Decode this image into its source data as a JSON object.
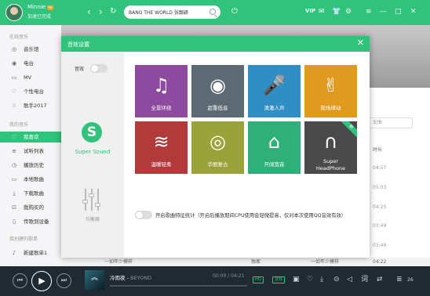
{
  "topbar": {
    "user_name": "Minnie",
    "level": "lv",
    "status": "加速已完成",
    "search_value": "BANG THE WORLD 张靓颖",
    "vip_label": "VIP",
    "icons": [
      "back-icon",
      "forward-icon",
      "refresh-icon",
      "search-icon",
      "download-arrow-icon",
      "mail-icon",
      "skin-icon",
      "settings-icon",
      "minimize-icon",
      "maximize-icon",
      "close-icon"
    ]
  },
  "sidebar": {
    "section_online": "在线音乐",
    "online_items": [
      {
        "label": "音乐馆",
        "icon": "music-hall-icon"
      },
      {
        "label": "电台",
        "icon": "radio-icon"
      },
      {
        "label": "MV",
        "icon": "mv-icon"
      },
      {
        "label": "个性电台",
        "icon": "personal-radio-icon"
      },
      {
        "label": "歌手2017",
        "icon": "singer-icon"
      }
    ],
    "section_my": "我的音乐",
    "my_items": [
      {
        "label": "我喜欢",
        "icon": "heart-icon",
        "active": true
      },
      {
        "label": "试听列表",
        "icon": "playlist-icon"
      },
      {
        "label": "播放历史",
        "icon": "history-icon"
      },
      {
        "label": "本地歌曲",
        "icon": "local-icon"
      },
      {
        "label": "下载歌曲",
        "icon": "download-icon"
      },
      {
        "label": "我购买的",
        "icon": "purchase-icon"
      },
      {
        "label": "传歌到设备",
        "icon": "device-icon"
      }
    ],
    "section_created": "我创建的歌单",
    "created_items": [
      {
        "label": "新建歌单1",
        "icon": "new-list-icon"
      }
    ]
  },
  "background": {
    "search_placeholder": "宏曲",
    "time_header": "时长",
    "times": [
      "04:57",
      "05:03",
      "04:25",
      "03:49",
      "03:49"
    ],
    "row_text": "一如年少模样",
    "row_tag": "独家",
    "row_artist": "陈鸿宇",
    "row_album": "一如年少模样",
    "row_time": "04:22"
  },
  "dialog": {
    "title": "音效设置",
    "toggle_label": "音效",
    "supersound_label": "Super Sound",
    "equalizer_label": "均衡器",
    "cards": [
      {
        "label": "全景环绕",
        "icon": "♫",
        "color": "#8e4a9e",
        "icon_name": "panorama-icon"
      },
      {
        "label": "超重低音",
        "icon": "◉",
        "color": "#5b6a73",
        "icon_name": "bass-icon"
      },
      {
        "label": "清澈人声",
        "icon": "🎤",
        "color": "#2f8fc4",
        "icon_name": "vocal-icon"
      },
      {
        "label": "现场律动",
        "icon": "✌",
        "color": "#e09a1e",
        "icon_name": "live-icon"
      },
      {
        "label": "温暖轻柔",
        "icon": "≋",
        "color": "#b33a3a",
        "icon_name": "warm-icon"
      },
      {
        "label": "华丽复古",
        "icon": "◎",
        "color": "#9aa33a",
        "icon_name": "vintage-icon"
      },
      {
        "label": "开阔宽音",
        "icon": "⌂",
        "color": "#2fb07a",
        "icon_name": "wide-icon"
      },
      {
        "label": "Super",
        "label2": "HeadPhone",
        "icon": "∩",
        "color": "#4a4a4a",
        "icon_name": "headphone-icon",
        "badge": "新"
      }
    ],
    "hint_text": "开启歌曲特征统计（开启后播放期间CPU使用会轻微提高，仅对本次使用QQ音效有效）"
  },
  "player": {
    "song": "冷雨夜",
    "artist": "BEYOND",
    "time": "00:00 / 04:21",
    "progress_fraction": 0.0,
    "quality": "HQ",
    "effect_badge": "音效",
    "count": "26"
  },
  "colors": {
    "accent": "#31c27c",
    "player_bg": "#1f2a33"
  }
}
